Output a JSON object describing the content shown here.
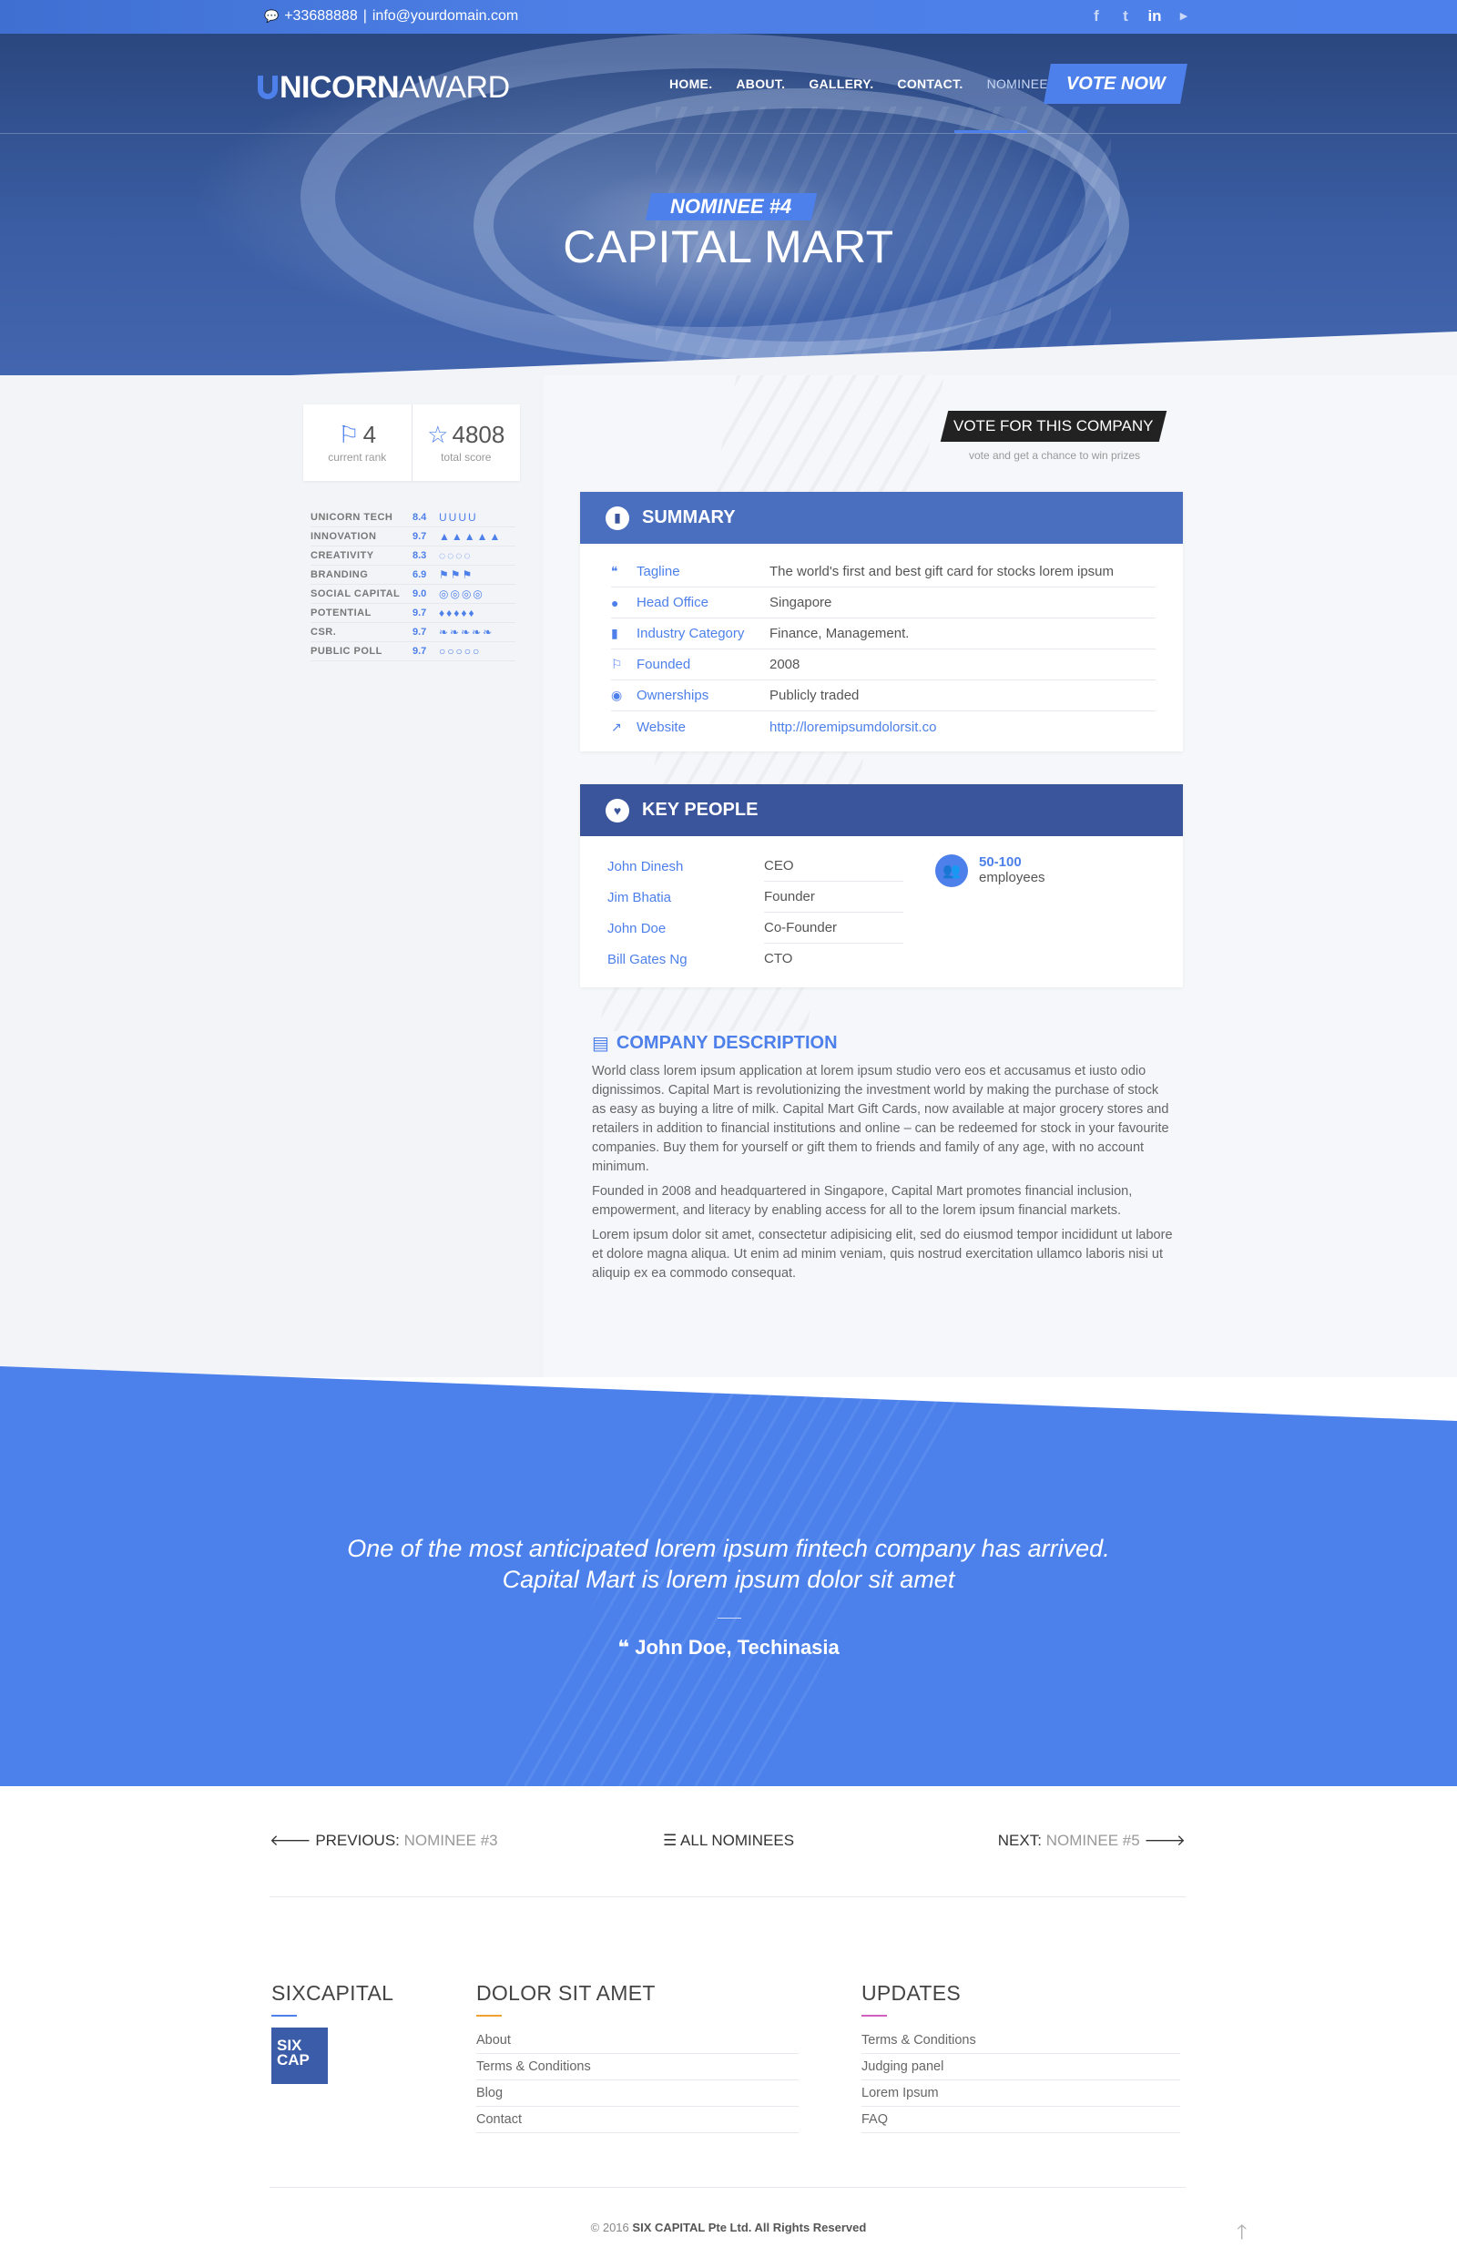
{
  "topbar": {
    "phone": "+33688888",
    "email": "info@yourdomain.com",
    "separator": "|",
    "social": [
      {
        "icon": "facebook-icon",
        "glyph": "f"
      },
      {
        "icon": "twitter-icon",
        "glyph": "t"
      },
      {
        "icon": "linkedin-icon",
        "glyph": "in"
      },
      {
        "icon": "youtube-icon",
        "glyph": "▶"
      }
    ]
  },
  "header": {
    "logo_bold": "NICORN",
    "logo_light": " AWARD",
    "nav": [
      "HOME.",
      "ABOUT.",
      "GALLERY.",
      "CONTACT.",
      "NOMINEES."
    ],
    "vote_button": "VOTE NOW"
  },
  "hero": {
    "badge": "NOMINEE #4",
    "title": "CAPITAL MART"
  },
  "stats": {
    "rank": "4",
    "rank_label": "current rank",
    "score": "4808",
    "score_label": "total score"
  },
  "scores": [
    {
      "name": "UNICORN TECH",
      "value": "8.4",
      "icons": "UUUU"
    },
    {
      "name": "INNOVATION",
      "value": "9.7",
      "icons": "▲▲▲▲▲"
    },
    {
      "name": "CREATIVITY",
      "value": "8.3",
      "icons": "◌◌◌◌"
    },
    {
      "name": "BRANDING",
      "value": "6.9",
      "icons": "⚑⚑⚑"
    },
    {
      "name": "SOCIAL CAPITAL",
      "value": "9.0",
      "icons": "◎◎◎◎"
    },
    {
      "name": "POTENTIAL",
      "value": "9.7",
      "icons": "♦♦♦♦♦"
    },
    {
      "name": "CSR.",
      "value": "9.7",
      "icons": "❧❧❧❧❧"
    },
    {
      "name": "PUBLIC POLL",
      "value": "9.7",
      "icons": "○○○○○"
    }
  ],
  "vote_company": {
    "label": "VOTE FOR THIS COMPANY",
    "sub": "vote and get a chance to win prizes"
  },
  "summary": {
    "title": "SUMMARY",
    "rows": [
      {
        "icon": "quote-icon",
        "glyph": "❝",
        "key": "Tagline",
        "value": "The world's first and best gift card for stocks lorem ipsum"
      },
      {
        "icon": "map-pin-icon",
        "glyph": "●",
        "key": "Head Office",
        "value": "Singapore"
      },
      {
        "icon": "bar-chart-icon",
        "glyph": "▮",
        "key": "Industry Category",
        "value": "Finance, Management."
      },
      {
        "icon": "flag-icon",
        "glyph": "⚐",
        "key": "Founded",
        "value": "2008"
      },
      {
        "icon": "globe-icon",
        "glyph": "◉",
        "key": "Ownerships",
        "value": "Publicly traded"
      },
      {
        "icon": "external-link-icon",
        "glyph": "↗",
        "key": "Website",
        "value": "http://loremipsumdolorsit.co"
      }
    ]
  },
  "key_people": {
    "title": "KEY PEOPLE",
    "people": [
      {
        "name": "John Dinesh",
        "role": "CEO"
      },
      {
        "name": "Jim Bhatia",
        "role": "Founder"
      },
      {
        "name": "John Doe",
        "role": "Co-Founder"
      },
      {
        "name": "Bill Gates Ng",
        "role": "CTO"
      }
    ],
    "employees_range": "50-100",
    "employees_label": "employees"
  },
  "description": {
    "title": "COMPANY DESCRIPTION",
    "paragraphs": [
      "World class lorem ipsum application at lorem ipsum studio vero eos et accusamus et iusto odio dignissimos. Capital Mart is revolutionizing the investment world by making the purchase of stock as easy as buying a litre of milk. Capital Mart  Gift Cards, now available at major grocery stores and retailers in addition to financial institutions and online – can be redeemed for stock in your favourite companies. Buy them for yourself or gift them to friends and family of any age, with no account minimum.",
      "Founded in 2008 and headquartered in Singapore, Capital Mart promotes financial inclusion, empowerment, and literacy by enabling access for all to the lorem ipsum financial markets.",
      "Lorem ipsum dolor sit amet, consectetur adipisicing elit, sed do eiusmod tempor incididunt ut labore et dolore magna aliqua. Ut enim ad minim veniam, quis nostrud exercitation ullamco laboris nisi ut aliquip ex ea commodo consequat."
    ]
  },
  "quote": {
    "line1": "One of the most anticipated  lorem ipsum fintech company has arrived.",
    "line2": "Capital Mart is lorem ipsum dolor sit amet",
    "author": "John Doe, Techinasia"
  },
  "pager": {
    "prev_label": "PREVIOUS:",
    "prev_value": "NOMINEE #3",
    "all_label": "ALL NOMINEES",
    "next_label": "NEXT:",
    "next_value": "NOMINEE #5"
  },
  "footer": {
    "col1_title": "SIXCAPITAL",
    "logo_line1": "SIX",
    "logo_line2": "CAP",
    "col2_title": "DOLOR SIT AMET",
    "col2_links": [
      "About",
      "Terms & Conditions",
      "Blog",
      "Contact"
    ],
    "col3_title": "UPDATES",
    "col3_links": [
      "Terms & Conditions",
      "Judging panel",
      "Lorem Ipsum",
      "FAQ"
    ],
    "copyright_prefix": "© 2016",
    "copyright_company": "SIX CAPITAL Pte Ltd. All Rights Reserved"
  },
  "colors": {
    "accent": "#4d80ea",
    "panel_blue": "#4a6fbf",
    "panel_dark": "#3b559c",
    "underline_orange": "#f0a030",
    "underline_pink": "#d05fc0"
  }
}
